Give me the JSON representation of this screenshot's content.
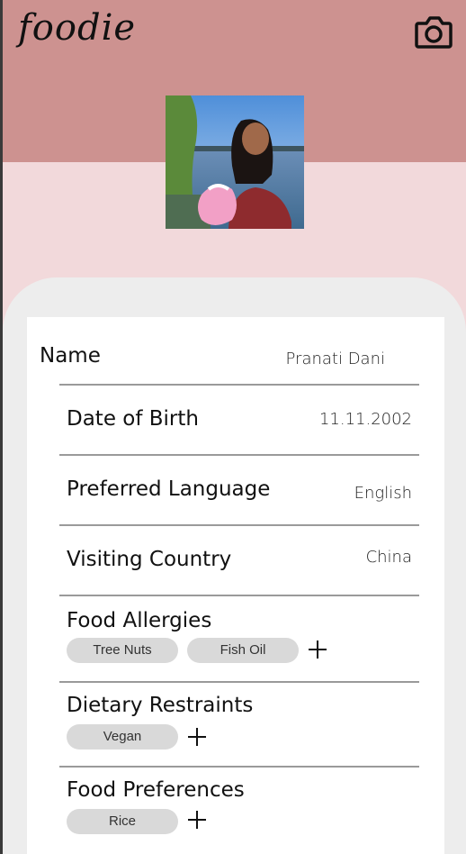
{
  "app": {
    "logo": "foodie"
  },
  "icons": {
    "camera": "camera-icon",
    "add": "plus-icon"
  },
  "colors": {
    "header": "#cd9290",
    "background": "#f2d9db",
    "card_bg": "#ededed",
    "chip": "#d9d9d9"
  },
  "profile": {
    "fields": [
      {
        "label": "Name",
        "value": "Pranati Dani"
      },
      {
        "label": "Date of Birth",
        "value": "11.11.2002"
      },
      {
        "label": "Preferred Language",
        "value": "English"
      },
      {
        "label": "Visiting Country",
        "value": "China"
      }
    ],
    "food_allergies": {
      "label": "Food Allergies",
      "tags": [
        "Tree Nuts",
        "Fish Oil"
      ]
    },
    "dietary_restraints": {
      "label": "Dietary Restraints",
      "tags": [
        "Vegan"
      ]
    },
    "food_preferences": {
      "label": "Food Preferences",
      "tags": [
        "Rice"
      ]
    }
  }
}
